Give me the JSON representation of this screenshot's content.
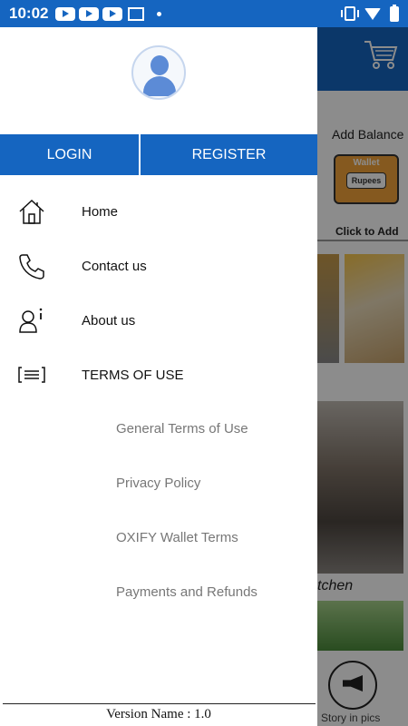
{
  "status_bar": {
    "time": "10:02"
  },
  "drawer": {
    "auth": {
      "login_label": "LOGIN",
      "register_label": "REGISTER"
    },
    "menu": [
      {
        "label": "Home",
        "icon": "home-icon"
      },
      {
        "label": "Contact us",
        "icon": "phone-icon"
      },
      {
        "label": "About us",
        "icon": "user-info-icon"
      },
      {
        "label": "TERMS OF USE",
        "icon": "terms-list-icon"
      }
    ],
    "terms_submenu": [
      "General Terms of Use",
      "Privacy Policy",
      "OXIFY Wallet Terms",
      "Payments and Refunds"
    ],
    "version": "Version Name : 1.0"
  },
  "background_app": {
    "add_balance": "Add Balance",
    "wallet_title": "Wallet",
    "wallet_button": "Rupees",
    "click_to_add": "Click to Add",
    "kitchen_caption": "tchen",
    "story_label": "Story in pics"
  },
  "colors": {
    "primary": "#1565c0",
    "avatar": "#5c8bd6",
    "wallet": "#f2a33a"
  }
}
